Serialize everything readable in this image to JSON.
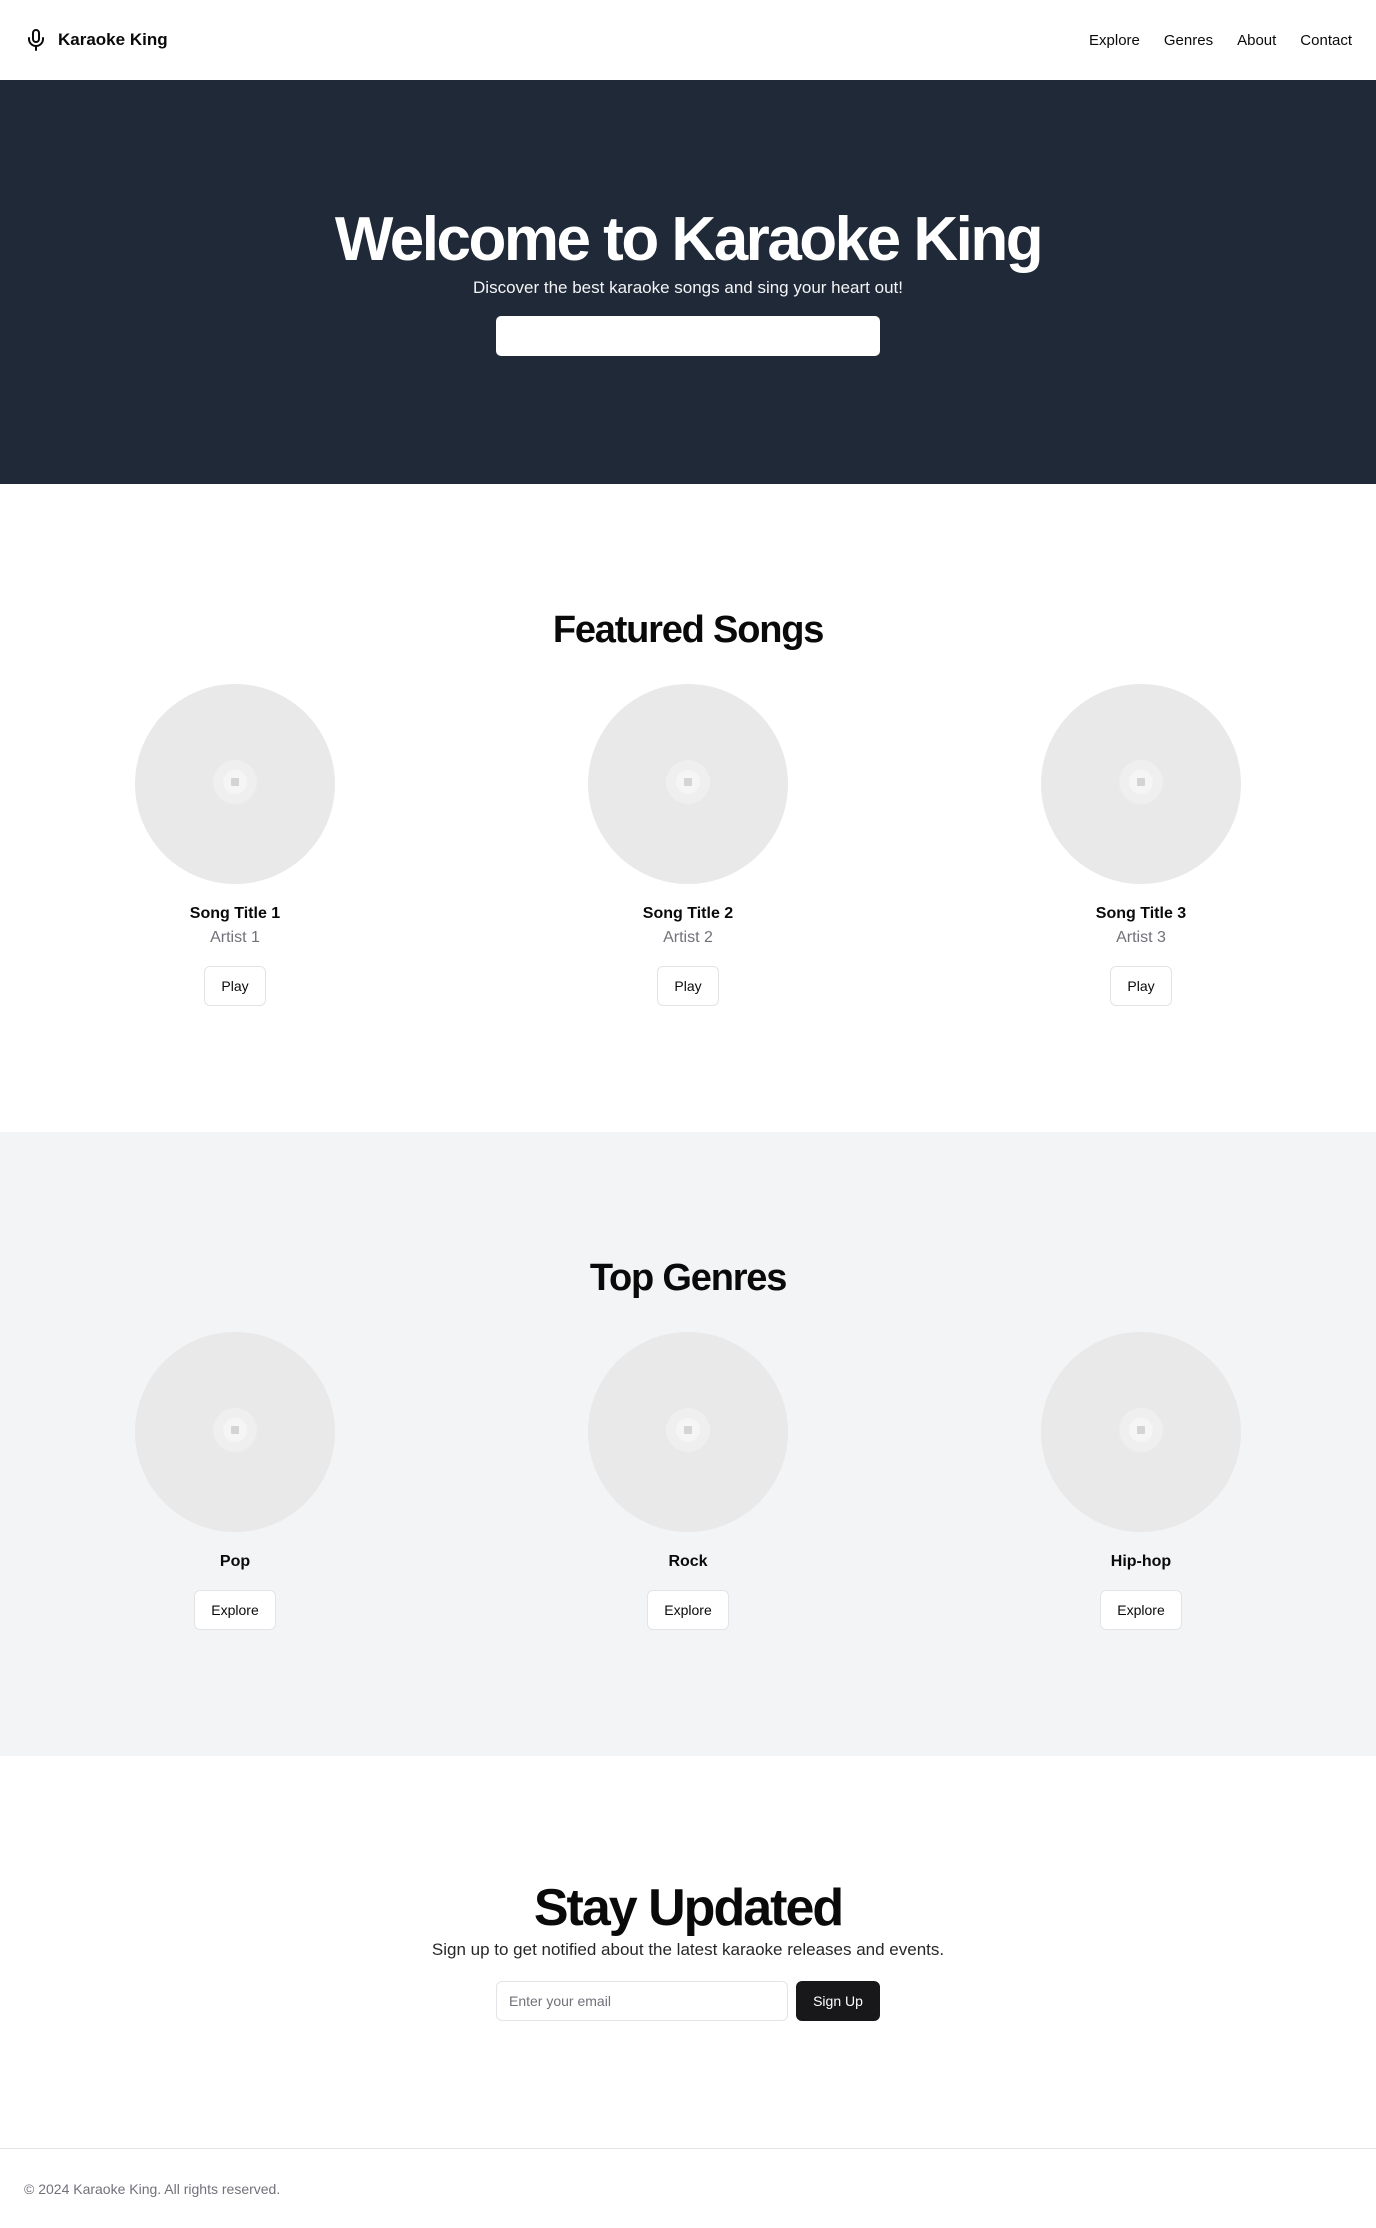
{
  "header": {
    "brand": "Karaoke King",
    "brand_icon": "microphone-icon",
    "nav": [
      "Explore",
      "Genres",
      "About",
      "Contact"
    ]
  },
  "hero": {
    "title": "Welcome to Karaoke King",
    "subtitle": "Discover the best karaoke songs and sing your heart out!",
    "search_value": "",
    "background_color": "#1f2937"
  },
  "featured": {
    "title": "Featured Songs",
    "songs": [
      {
        "title": "Song Title 1",
        "artist": "Artist 1",
        "button": "Play",
        "image_icon": "placeholder-image-icon"
      },
      {
        "title": "Song Title 2",
        "artist": "Artist 2",
        "button": "Play",
        "image_icon": "placeholder-image-icon"
      },
      {
        "title": "Song Title 3",
        "artist": "Artist 3",
        "button": "Play",
        "image_icon": "placeholder-image-icon"
      }
    ]
  },
  "genres": {
    "title": "Top Genres",
    "items": [
      {
        "name": "Pop",
        "button": "Explore",
        "image_icon": "placeholder-image-icon"
      },
      {
        "name": "Rock",
        "button": "Explore",
        "image_icon": "placeholder-image-icon"
      },
      {
        "name": "Hip-hop",
        "button": "Explore",
        "image_icon": "placeholder-image-icon"
      }
    ],
    "background_color": "#f3f4f6"
  },
  "newsletter": {
    "title": "Stay Updated",
    "subtitle": "Sign up to get notified about the latest karaoke releases and events.",
    "email_placeholder": "Enter your email",
    "email_value": "",
    "button": "Sign Up",
    "button_color": "#18181b"
  },
  "footer": {
    "text": "© 2024 Karaoke King. All rights reserved."
  }
}
